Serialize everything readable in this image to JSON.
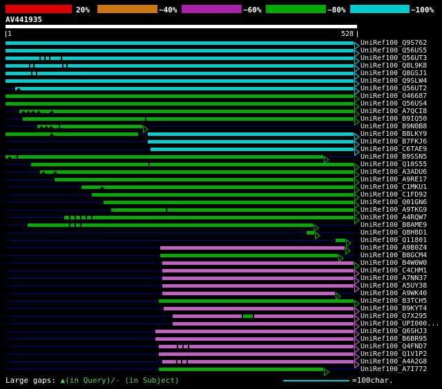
{
  "colors": {
    "red": "#dd0000",
    "orange": "#cc7711",
    "purple": "#aa22aa",
    "green": "#00aa00",
    "cyan": "#00cccc",
    "magenta": "#c060c0",
    "navy": "#000077",
    "white": "#ffffff",
    "legend_green": "#66cc66"
  },
  "scale": {
    "labels": [
      "20%",
      "~40%",
      "~60%",
      "~80%",
      "~100%"
    ]
  },
  "query": {
    "name": "AV441935",
    "start_label": "1",
    "end_label": "528"
  },
  "legend": {
    "gaps_label": "Large gaps: ",
    "gaps_detail": "▲(in Query)/- (in Subject)",
    "scale_line_label": "=100char."
  },
  "chart_data": {
    "type": "table",
    "title": "Graphical overview of similarity search hits for query AV441935",
    "query_id": "AV441935",
    "query_length": 528,
    "identity_legend": [
      {
        "label": "20%",
        "color_key": "red"
      },
      {
        "label": "~40%",
        "color_key": "orange"
      },
      {
        "label": "~60%",
        "color_key": "purple"
      },
      {
        "label": "~80%",
        "color_key": "green"
      },
      {
        "label": "~100%",
        "color_key": "cyan"
      }
    ],
    "hits": [
      {
        "id": "UniRef100_Q9S762",
        "segments": [
          {
            "from": 1,
            "to": 528,
            "color_key": "cyan"
          }
        ],
        "marks": []
      },
      {
        "id": "UniRef100_Q56US5",
        "segments": [
          {
            "from": 1,
            "to": 528,
            "color_key": "cyan"
          }
        ],
        "marks": []
      },
      {
        "id": "UniRef100_Q56UT3",
        "segments": [
          {
            "from": 1,
            "to": 528,
            "color_key": "cyan"
          }
        ],
        "marks": [
          {
            "pos": 52,
            "type": "dash"
          },
          {
            "pos": 60,
            "type": "dash"
          },
          {
            "pos": 67,
            "type": "dash"
          },
          {
            "pos": 85,
            "type": "dash"
          }
        ]
      },
      {
        "id": "UniRef100_Q8L9K8",
        "segments": [
          {
            "from": 1,
            "to": 528,
            "color_key": "cyan"
          }
        ],
        "marks": [
          {
            "pos": 37,
            "type": "dash"
          },
          {
            "pos": 43,
            "type": "dash"
          },
          {
            "pos": 87,
            "type": "dash"
          },
          {
            "pos": 93,
            "type": "dash"
          }
        ]
      },
      {
        "id": "UniRef100_Q8GSJ1",
        "segments": [
          {
            "from": 1,
            "to": 528,
            "color_key": "cyan"
          }
        ],
        "marks": [
          {
            "pos": 40,
            "type": "dash"
          },
          {
            "pos": 47,
            "type": "dash"
          }
        ]
      },
      {
        "id": "UniRef100_Q9SLW4",
        "segments": [
          {
            "from": 1,
            "to": 528,
            "color_key": "cyan"
          }
        ],
        "marks": []
      },
      {
        "id": "UniRef100_Q56UT2",
        "segments": [
          {
            "from": 16,
            "to": 528,
            "color_key": "cyan"
          }
        ],
        "marks": [
          {
            "pos": 21,
            "type": "tri"
          }
        ]
      },
      {
        "id": "UniRef100_O46687",
        "segments": [
          {
            "from": 1,
            "to": 528,
            "color_key": "green"
          }
        ],
        "marks": []
      },
      {
        "id": "UniRef100_Q56US4",
        "segments": [
          {
            "from": 1,
            "to": 528,
            "color_key": "green"
          }
        ],
        "marks": []
      },
      {
        "id": "UniRef100_A7QCI8",
        "segments": [
          {
            "from": 22,
            "to": 528,
            "color_key": "green"
          }
        ],
        "marks": [
          {
            "pos": 28,
            "type": "tri"
          },
          {
            "pos": 35,
            "type": "tri"
          },
          {
            "pos": 43,
            "type": "tri"
          },
          {
            "pos": 51,
            "type": "tri"
          },
          {
            "pos": 71,
            "type": "tri"
          }
        ]
      },
      {
        "id": "UniRef100_B9IQ50",
        "segments": [
          {
            "from": 27,
            "to": 528,
            "color_key": "green"
          }
        ],
        "marks": [
          {
            "pos": 212,
            "type": "dash"
          }
        ]
      },
      {
        "id": "UniRef100_B9N0B8",
        "segments": [
          {
            "from": 49,
            "to": 208,
            "color_key": "green"
          }
        ],
        "marks": [
          {
            "pos": 55,
            "type": "tri"
          },
          {
            "pos": 63,
            "type": "tri"
          },
          {
            "pos": 70,
            "type": "tri"
          },
          {
            "pos": 81,
            "type": "dash"
          }
        ]
      },
      {
        "id": "UniRef100_B8LKY9",
        "segments": [
          {
            "from": 1,
            "to": 202,
            "color_key": "green"
          },
          {
            "from": 216,
            "to": 528,
            "color_key": "cyan"
          }
        ],
        "marks": [
          {
            "pos": 71,
            "type": "tri"
          }
        ]
      },
      {
        "id": "UniRef100_B7FKJ6",
        "segments": [
          {
            "from": 216,
            "to": 528,
            "color_key": "cyan"
          }
        ],
        "marks": []
      },
      {
        "id": "UniRef100_C6TAE9",
        "segments": [
          {
            "from": 221,
            "to": 528,
            "color_key": "cyan"
          }
        ],
        "marks": []
      },
      {
        "id": "UniRef100_B9SSN5",
        "segments": [
          {
            "from": 1,
            "to": 482,
            "color_key": "green"
          }
        ],
        "marks": [
          {
            "pos": 7,
            "type": "tri"
          },
          {
            "pos": 18,
            "type": "dash"
          }
        ]
      },
      {
        "id": "UniRef100_Q10S55",
        "segments": [
          {
            "from": 40,
            "to": 528,
            "color_key": "green"
          }
        ],
        "marks": [
          {
            "pos": 217,
            "type": "dash"
          }
        ]
      },
      {
        "id": "UniRef100_A3ADU6",
        "segments": [
          {
            "from": 53,
            "to": 528,
            "color_key": "green"
          }
        ],
        "marks": [
          {
            "pos": 58,
            "type": "tri"
          },
          {
            "pos": 76,
            "type": "tri"
          }
        ]
      },
      {
        "id": "UniRef100_A9RE17",
        "segments": [
          {
            "from": 75,
            "to": 528,
            "color_key": "green"
          }
        ],
        "marks": []
      },
      {
        "id": "UniRef100_C1MKU1",
        "segments": [
          {
            "from": 116,
            "to": 528,
            "color_key": "green"
          }
        ],
        "marks": [
          {
            "pos": 147,
            "type": "tri"
          }
        ]
      },
      {
        "id": "UniRef100_C1FD92",
        "segments": [
          {
            "from": 132,
            "to": 528,
            "color_key": "green"
          }
        ],
        "marks": []
      },
      {
        "id": "UniRef100_Q01GN6",
        "segments": [
          {
            "from": 149,
            "to": 528,
            "color_key": "green"
          }
        ],
        "marks": []
      },
      {
        "id": "UniRef100_A9TKG9",
        "segments": [
          {
            "from": 161,
            "to": 528,
            "color_key": "green"
          }
        ],
        "marks": [
          {
            "pos": 244,
            "type": "dash"
          }
        ]
      },
      {
        "id": "UniRef100_A4RQW7",
        "segments": [
          {
            "from": 90,
            "to": 528,
            "color_key": "green"
          }
        ],
        "marks": [
          {
            "pos": 97,
            "type": "dash"
          },
          {
            "pos": 106,
            "type": "dash"
          },
          {
            "pos": 114,
            "type": "dash"
          },
          {
            "pos": 122,
            "type": "dash"
          },
          {
            "pos": 131,
            "type": "dash"
          }
        ]
      },
      {
        "id": "UniRef100_B8AME9",
        "segments": [
          {
            "from": 34,
            "to": 466,
            "color_key": "green"
          }
        ],
        "marks": [
          {
            "pos": 97,
            "type": "dash"
          },
          {
            "pos": 106,
            "type": "dash"
          },
          {
            "pos": 114,
            "type": "dash"
          }
        ]
      },
      {
        "id": "UniRef100_Q8H8D1",
        "segments": [
          {
            "from": 457,
            "to": 468,
            "color_key": "green"
          }
        ],
        "marks": []
      },
      {
        "id": "UniRef100_Q11801",
        "segments": [
          {
            "from": 501,
            "to": 515,
            "color_key": "green"
          }
        ],
        "marks": []
      },
      {
        "id": "UniRef100_A9B0Z4",
        "segments": [
          {
            "from": 235,
            "to": 514,
            "color_key": "magenta"
          }
        ],
        "arrow_color_key": "green",
        "marks": []
      },
      {
        "id": "UniRef100_B8GCM4",
        "segments": [
          {
            "from": 235,
            "to": 504,
            "color_key": "green"
          }
        ],
        "marks": []
      },
      {
        "id": "UniRef100_B4W0W0",
        "segments": [
          {
            "from": 238,
            "to": 528,
            "color_key": "magenta"
          }
        ],
        "arrow_color_key": "green",
        "marks": []
      },
      {
        "id": "UniRef100_C4CHM1",
        "segments": [
          {
            "from": 238,
            "to": 528,
            "color_key": "magenta"
          }
        ],
        "marks": []
      },
      {
        "id": "UniRef100_A7NN37",
        "segments": [
          {
            "from": 238,
            "to": 528,
            "color_key": "magenta"
          }
        ],
        "marks": []
      },
      {
        "id": "UniRef100_A5UY38",
        "segments": [
          {
            "from": 238,
            "to": 528,
            "color_key": "magenta"
          }
        ],
        "marks": []
      },
      {
        "id": "UniRef100_A9WK40",
        "segments": [
          {
            "from": 238,
            "to": 500,
            "color_key": "magenta"
          }
        ],
        "arrow_color_key": "green",
        "marks": []
      },
      {
        "id": "UniRef100_B3TCH5",
        "segments": [
          {
            "from": 233,
            "to": 528,
            "color_key": "green"
          }
        ],
        "marks": []
      },
      {
        "id": "UniRef100_B9KYT4",
        "segments": [
          {
            "from": 240,
            "to": 528,
            "color_key": "magenta"
          }
        ],
        "marks": []
      },
      {
        "id": "UniRef100_Q7X295",
        "segments": [
          {
            "from": 254,
            "to": 359,
            "color_key": "magenta"
          },
          {
            "from": 361,
            "to": 375,
            "color_key": "green"
          },
          {
            "from": 377,
            "to": 528,
            "color_key": "magenta"
          }
        ],
        "marks": []
      },
      {
        "id": "UniRef100_UPI000...",
        "segments": [
          {
            "from": 254,
            "to": 528,
            "color_key": "magenta"
          }
        ],
        "marks": []
      },
      {
        "id": "UniRef100_Q6SHJ3",
        "segments": [
          {
            "from": 228,
            "to": 528,
            "color_key": "magenta"
          }
        ],
        "marks": []
      },
      {
        "id": "UniRef100_B6BR95",
        "segments": [
          {
            "from": 228,
            "to": 528,
            "color_key": "magenta"
          }
        ],
        "marks": []
      },
      {
        "id": "UniRef100_Q4FND7",
        "segments": [
          {
            "from": 233,
            "to": 528,
            "color_key": "magenta"
          }
        ],
        "marks": [
          {
            "pos": 260,
            "type": "dash"
          },
          {
            "pos": 269,
            "type": "dash"
          },
          {
            "pos": 277,
            "type": "dash"
          }
        ]
      },
      {
        "id": "UniRef100_Q1V1P2",
        "segments": [
          {
            "from": 233,
            "to": 528,
            "color_key": "magenta"
          }
        ],
        "marks": []
      },
      {
        "id": "UniRef100_A4A2G8",
        "segments": [
          {
            "from": 238,
            "to": 528,
            "color_key": "magenta"
          }
        ],
        "marks": [
          {
            "pos": 259,
            "type": "dash"
          },
          {
            "pos": 267,
            "type": "dash"
          },
          {
            "pos": 275,
            "type": "dash"
          }
        ]
      },
      {
        "id": "UniRef100_A7I772",
        "segments": [
          {
            "from": 233,
            "to": 482,
            "color_key": "green"
          }
        ],
        "marks": []
      }
    ]
  }
}
